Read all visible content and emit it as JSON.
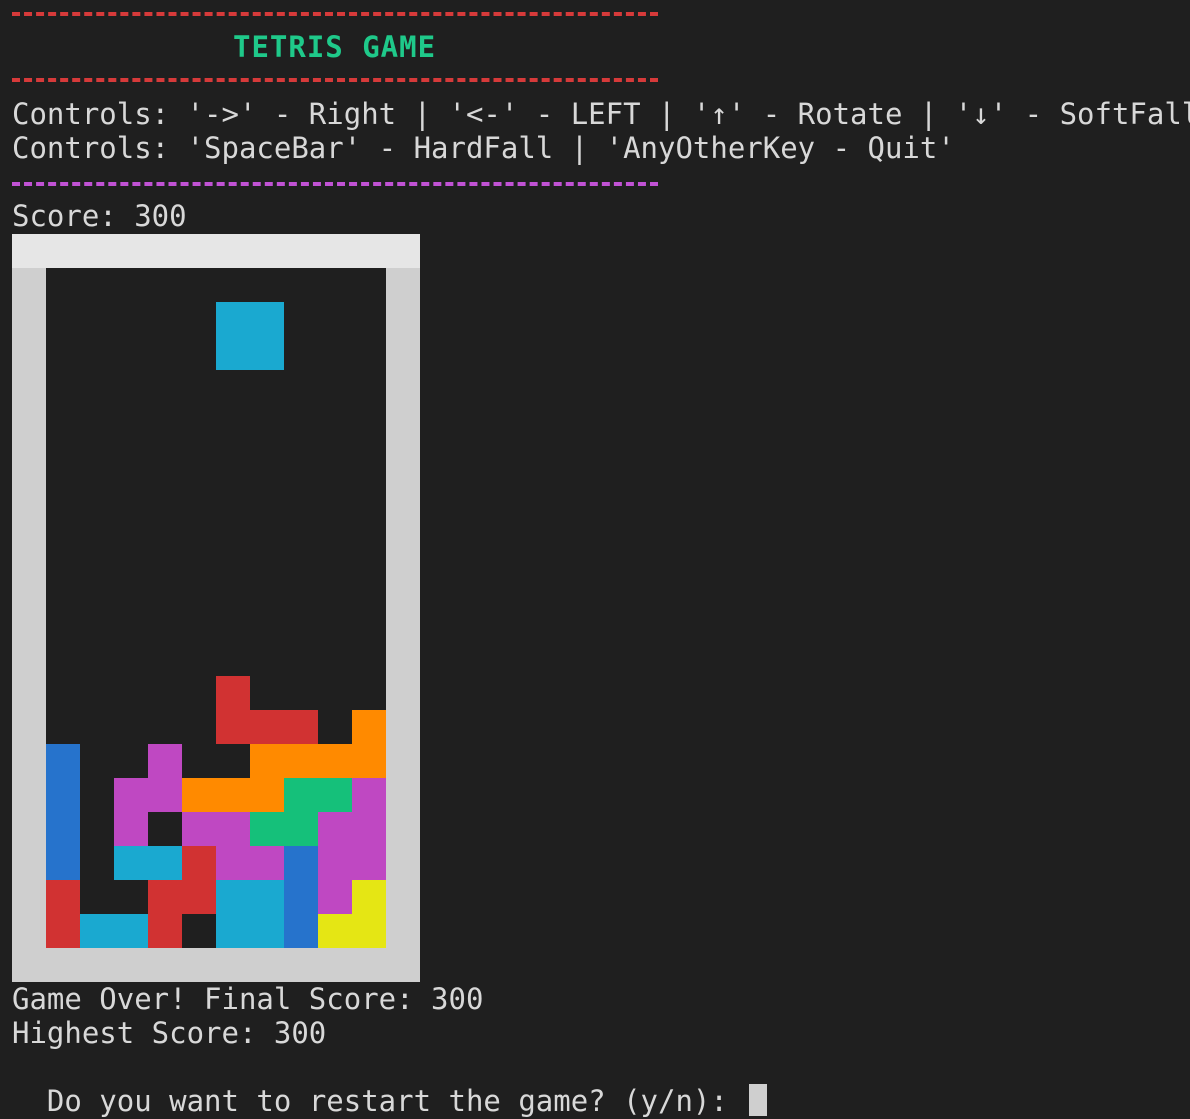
{
  "header": {
    "title": "TETRIS GAME",
    "controls_line1": "Controls: '->' - Right | '<-' - LEFT | '↑' - Rotate | '↓' - SoftFall",
    "controls_line2": "Controls: 'SpaceBar' - HardFall | 'AnyOtherKey - Quit'"
  },
  "score_label": "Score: 300",
  "board": {
    "columns": 10,
    "rows": 20,
    "colors": {
      "I": "#1aa9d0",
      "J": "#2673cc",
      "Z": "#d13232",
      "T": "#bf48c2",
      "L": "#ff8a00",
      "S": "#15c07a",
      "O": "#e5e614"
    },
    "cells": [
      {
        "col": 5,
        "row": 1,
        "piece": "I"
      },
      {
        "col": 5,
        "row": 2,
        "piece": "I"
      },
      {
        "col": 6,
        "row": 1,
        "piece": "I"
      },
      {
        "col": 6,
        "row": 2,
        "piece": "I"
      },
      {
        "col": 5,
        "row": 12,
        "piece": "Z"
      },
      {
        "col": 5,
        "row": 13,
        "piece": "Z"
      },
      {
        "col": 6,
        "row": 13,
        "piece": "Z"
      },
      {
        "col": 7,
        "row": 13,
        "piece": "Z"
      },
      {
        "col": 9,
        "row": 13,
        "piece": "L"
      },
      {
        "col": 0,
        "row": 14,
        "piece": "J"
      },
      {
        "col": 3,
        "row": 14,
        "piece": "T"
      },
      {
        "col": 6,
        "row": 14,
        "piece": "L"
      },
      {
        "col": 7,
        "row": 14,
        "piece": "L"
      },
      {
        "col": 8,
        "row": 14,
        "piece": "L"
      },
      {
        "col": 9,
        "row": 14,
        "piece": "L"
      },
      {
        "col": 0,
        "row": 15,
        "piece": "J"
      },
      {
        "col": 2,
        "row": 15,
        "piece": "T"
      },
      {
        "col": 3,
        "row": 15,
        "piece": "T"
      },
      {
        "col": 4,
        "row": 15,
        "piece": "L"
      },
      {
        "col": 5,
        "row": 15,
        "piece": "L"
      },
      {
        "col": 6,
        "row": 15,
        "piece": "L"
      },
      {
        "col": 7,
        "row": 15,
        "piece": "S"
      },
      {
        "col": 8,
        "row": 15,
        "piece": "S"
      },
      {
        "col": 9,
        "row": 15,
        "piece": "T"
      },
      {
        "col": 0,
        "row": 16,
        "piece": "J"
      },
      {
        "col": 2,
        "row": 16,
        "piece": "T"
      },
      {
        "col": 4,
        "row": 16,
        "piece": "T"
      },
      {
        "col": 5,
        "row": 16,
        "piece": "T"
      },
      {
        "col": 6,
        "row": 16,
        "piece": "S"
      },
      {
        "col": 7,
        "row": 16,
        "piece": "S"
      },
      {
        "col": 8,
        "row": 16,
        "piece": "T"
      },
      {
        "col": 9,
        "row": 16,
        "piece": "T"
      },
      {
        "col": 0,
        "row": 17,
        "piece": "J"
      },
      {
        "col": 2,
        "row": 17,
        "piece": "I"
      },
      {
        "col": 3,
        "row": 17,
        "piece": "I"
      },
      {
        "col": 4,
        "row": 17,
        "piece": "Z"
      },
      {
        "col": 5,
        "row": 17,
        "piece": "T"
      },
      {
        "col": 6,
        "row": 17,
        "piece": "T"
      },
      {
        "col": 7,
        "row": 17,
        "piece": "J"
      },
      {
        "col": 8,
        "row": 17,
        "piece": "T"
      },
      {
        "col": 9,
        "row": 17,
        "piece": "T"
      },
      {
        "col": 0,
        "row": 18,
        "piece": "Z"
      },
      {
        "col": 3,
        "row": 18,
        "piece": "Z"
      },
      {
        "col": 4,
        "row": 18,
        "piece": "Z"
      },
      {
        "col": 5,
        "row": 18,
        "piece": "I"
      },
      {
        "col": 6,
        "row": 18,
        "piece": "I"
      },
      {
        "col": 7,
        "row": 18,
        "piece": "J"
      },
      {
        "col": 8,
        "row": 18,
        "piece": "T"
      },
      {
        "col": 9,
        "row": 18,
        "piece": "O"
      },
      {
        "col": 0,
        "row": 19,
        "piece": "Z"
      },
      {
        "col": 1,
        "row": 19,
        "piece": "I"
      },
      {
        "col": 2,
        "row": 19,
        "piece": "I"
      },
      {
        "col": 3,
        "row": 19,
        "piece": "Z"
      },
      {
        "col": 5,
        "row": 19,
        "piece": "I"
      },
      {
        "col": 6,
        "row": 19,
        "piece": "I"
      },
      {
        "col": 7,
        "row": 19,
        "piece": "J"
      },
      {
        "col": 8,
        "row": 19,
        "piece": "O"
      },
      {
        "col": 9,
        "row": 19,
        "piece": "O"
      }
    ]
  },
  "footer": {
    "game_over": "Game Over! Final Score: 300",
    "highest": "Highest Score: 300",
    "prompt": "Do you want to restart the game? (y/n): "
  }
}
